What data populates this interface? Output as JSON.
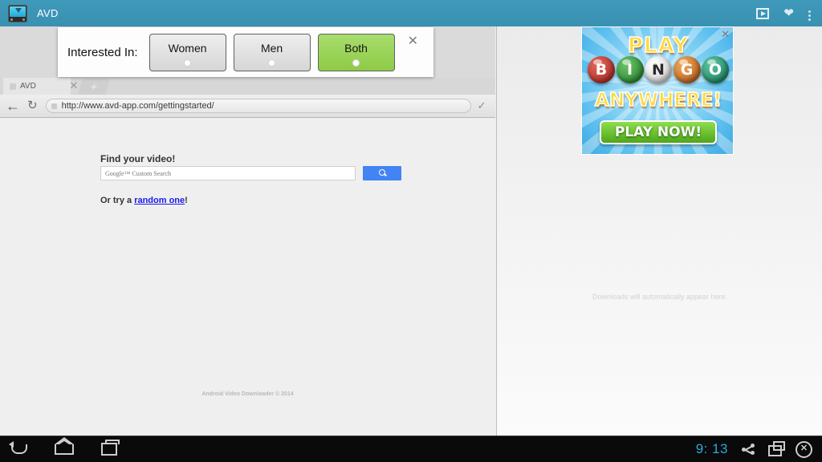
{
  "appbar": {
    "title": "AVD",
    "icon": "avd-monitor-download-icon",
    "actions": [
      {
        "name": "play-button",
        "icon": "play-icon"
      },
      {
        "name": "favorites-button",
        "icon": "heart-icon"
      },
      {
        "name": "overflow-menu-button",
        "icon": "three-dots-icon"
      }
    ],
    "background_color": "#3c94b5"
  },
  "dialog": {
    "label": "Interested In:",
    "close_label": "✕",
    "options": [
      {
        "label": "Women",
        "selected": false
      },
      {
        "label": "Men",
        "selected": false
      },
      {
        "label": "Both",
        "selected": true
      }
    ],
    "selected_color": "#8ecb46"
  },
  "browser": {
    "tab": {
      "title": "AVD",
      "close_label": "✕"
    },
    "new_tab_label": "+",
    "back_label": "←",
    "reload_label": "↻",
    "url": "http://www.avd-app.com/gettingstarted/",
    "go_label": "✓"
  },
  "page": {
    "heading": "Find your video!",
    "search_placeholder": "Google™ Custom Search",
    "search_value": "",
    "search_button_icon": "magnifier-icon",
    "random_prefix": "Or try a ",
    "random_link": "random one",
    "random_suffix": "!",
    "footer": "Android Video Downloader © 2014"
  },
  "downloads": {
    "empty_message": "Downloads will automatically appear here."
  },
  "ad": {
    "line1": "PLAY",
    "balls": [
      {
        "letter": "B",
        "color": "#a81f16"
      },
      {
        "letter": "I",
        "color": "#197d25"
      },
      {
        "letter": "N",
        "color": "#c9c9c9"
      },
      {
        "letter": "G",
        "color": "#b4550d"
      },
      {
        "letter": "O",
        "color": "#0f7a58"
      }
    ],
    "line2": "ANYWHERE!",
    "cta": "PLAY NOW!",
    "close_label": "✕"
  },
  "navbar": {
    "back": "back-icon",
    "home": "home-icon",
    "recents": "recent-apps-icon",
    "clock": "9: 13",
    "clock_color": "#2ea8d8",
    "share": "share-icon",
    "screenshot": "screenshot-icon",
    "close": "close-circle-icon"
  }
}
